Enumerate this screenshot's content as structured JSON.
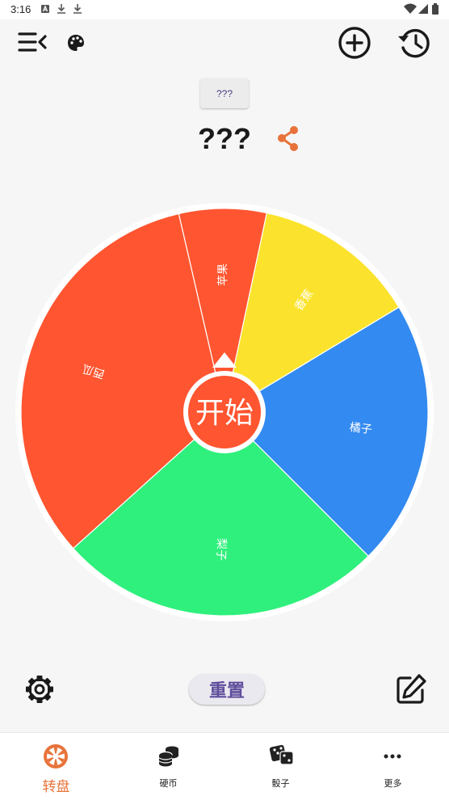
{
  "status_bar": {
    "time": "3:16",
    "icons": [
      "a-icon",
      "download-icon",
      "download-icon",
      "wifi-icon",
      "signal-icon",
      "battery-icon"
    ]
  },
  "toolbar": {
    "menu_icon": "menu-collapse-icon",
    "palette_icon": "palette-icon",
    "add_icon": "add-circle-icon",
    "history_icon": "history-icon"
  },
  "wheel": {
    "question_button": "???",
    "title": "???",
    "share_icon": "share-icon",
    "start_label": "开始",
    "segments": [
      {
        "label": "苹果",
        "color": "#ff5530",
        "start_deg": -13,
        "end_deg": 12
      },
      {
        "label": "香蕉",
        "color": "#fbe32d",
        "start_deg": 12,
        "end_deg": 59
      },
      {
        "label": "橘子",
        "color": "#338af0",
        "start_deg": 59,
        "end_deg": 135
      },
      {
        "label": "梨子",
        "color": "#2ff07c",
        "start_deg": 135,
        "end_deg": 228
      },
      {
        "label": "西瓜",
        "color": "#ff5530",
        "start_deg": 228,
        "end_deg": 347
      }
    ],
    "colors": {
      "rim": "#ffffff",
      "hub": "#ff5530",
      "divider": "#ffffff"
    }
  },
  "actions": {
    "settings_icon": "gear-icon",
    "reset_label": "重置",
    "edit_icon": "edit-icon"
  },
  "bottom_nav": {
    "items": [
      {
        "label": "转盘",
        "icon": "wheel-icon",
        "active": true
      },
      {
        "label": "硬币",
        "icon": "coins-icon",
        "active": false
      },
      {
        "label": "骰子",
        "icon": "dice-icon",
        "active": false
      },
      {
        "label": "更多",
        "icon": "more-icon",
        "active": false
      }
    ],
    "accent": "#e8733a"
  }
}
